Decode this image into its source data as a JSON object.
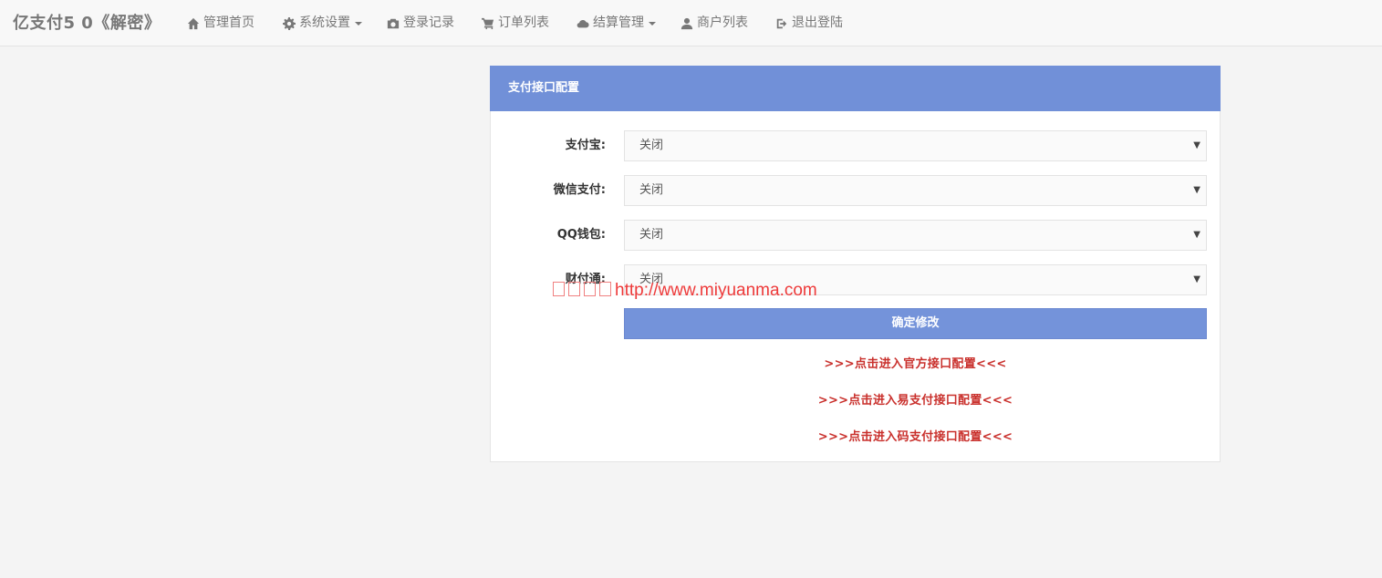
{
  "brand": "亿支付5 0《解密》",
  "nav": {
    "home": "管理首页",
    "settings": "系统设置",
    "login_log": "登录记录",
    "orders": "订单列表",
    "settlement": "结算管理",
    "merchants": "商户列表",
    "logout": "退出登陆"
  },
  "panel": {
    "title": "支付接口配置",
    "fields": [
      {
        "label": "支付宝:",
        "value": "关闭"
      },
      {
        "label": "微信支付:",
        "value": "关闭"
      },
      {
        "label": "QQ钱包:",
        "value": "关闭"
      },
      {
        "label": "财付通:",
        "value": "关闭"
      }
    ],
    "submit_label": "确定修改",
    "links": [
      ">>>点击进入官方接口配置<<<",
      ">>>点击进入易支付接口配置<<<",
      ">>>点击进入码支付接口配置<<<"
    ]
  },
  "watermark": "http://www.miyuanma.com",
  "colors": {
    "header": "#7190d8",
    "button": "#7493da",
    "link_red": "#c9302c",
    "watermark": "#ee3a3a"
  },
  "icons": [
    "home-icon",
    "gear-icon",
    "camera-icon",
    "cart-icon",
    "cloud-icon",
    "user-icon",
    "logout-icon"
  ]
}
